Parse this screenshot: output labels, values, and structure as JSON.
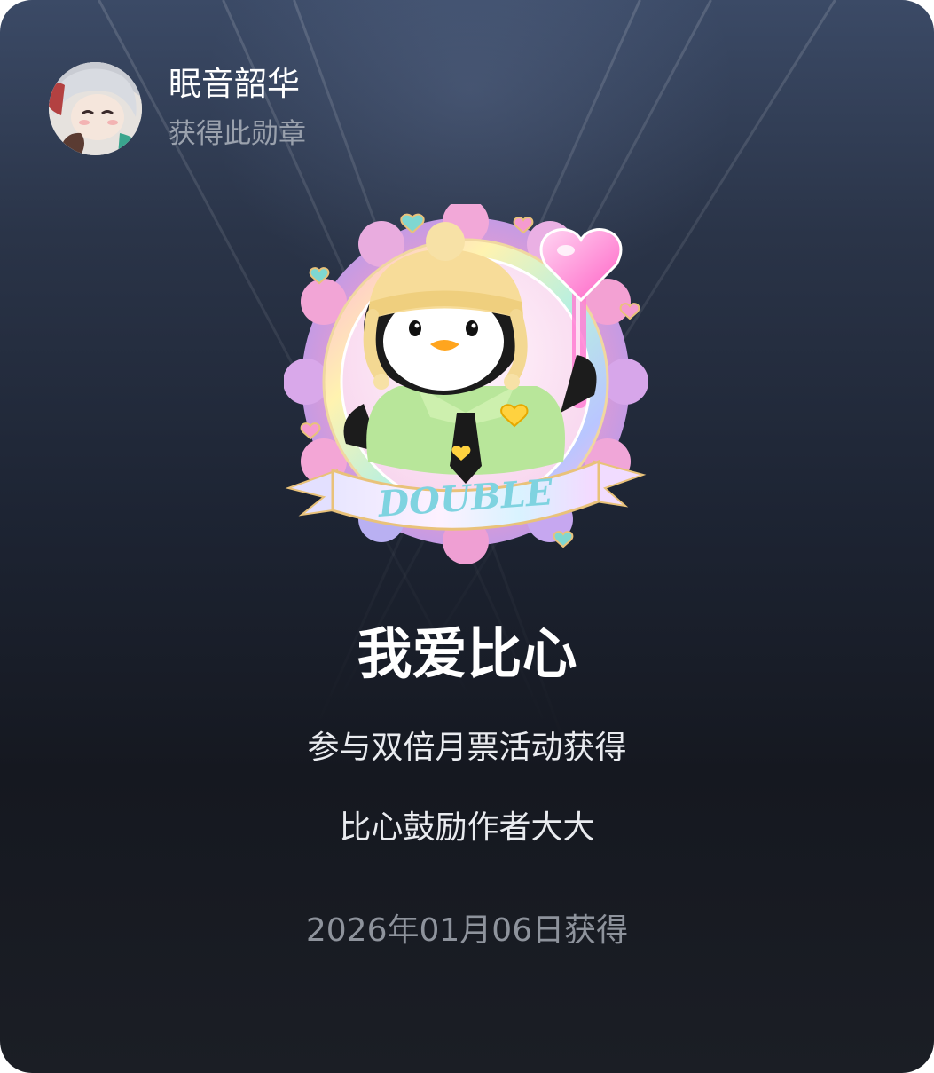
{
  "user": {
    "name": "眠音韶华",
    "subtitle": "获得此勋章"
  },
  "badge": {
    "icon": "penguin-heart-badge-icon",
    "ribbon_text": "DOUBLE",
    "title": "我爱比心",
    "description_line1": "参与双倍月票活动获得",
    "description_line2": "比心鼓励作者大大",
    "obtained_date": "2026年01月06日获得"
  },
  "colors": {
    "title": "#ffffff",
    "subtitle": "#9aa1ad",
    "date": "#8e939c",
    "ribbon_text": "#7fd3e0"
  }
}
